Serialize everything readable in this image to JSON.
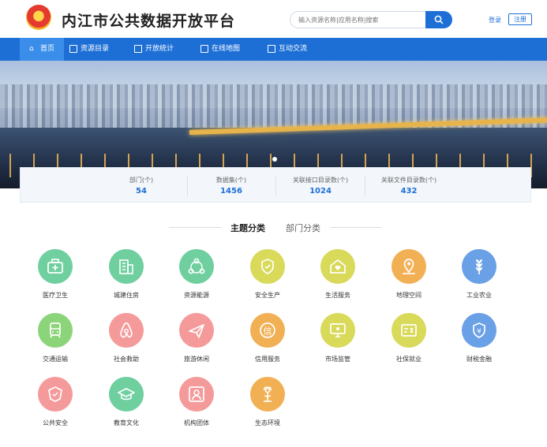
{
  "header": {
    "site_title": "内江市公共数据开放平台",
    "search_placeholder": "输入资源名称|应用名称|搜索",
    "login_label": "登录",
    "register_label": "注册"
  },
  "nav": {
    "items": [
      {
        "label": "首页",
        "icon": "home-icon"
      },
      {
        "label": "资源目录",
        "icon": "catalog-icon"
      },
      {
        "label": "开放统计",
        "icon": "stats-icon"
      },
      {
        "label": "在线地图",
        "icon": "map-icon"
      },
      {
        "label": "互动交流",
        "icon": "chat-icon"
      }
    ]
  },
  "stats": [
    {
      "label": "部门(个)",
      "value": "54"
    },
    {
      "label": "数据集(个)",
      "value": "1456"
    },
    {
      "label": "关联接口目录数(个)",
      "value": "1024"
    },
    {
      "label": "关联文件目录数(个)",
      "value": "432"
    }
  ],
  "tabs": {
    "topic": "主题分类",
    "department": "部门分类"
  },
  "categories": [
    {
      "label": "医疗卫生",
      "color": "#6fcf9f",
      "icon": "medical-kit-icon"
    },
    {
      "label": "城建住房",
      "color": "#6fcf9f",
      "icon": "building-icon"
    },
    {
      "label": "资源能源",
      "color": "#6fcf9f",
      "icon": "network-icon"
    },
    {
      "label": "安全生产",
      "color": "#d9d95a",
      "icon": "shield-icon"
    },
    {
      "label": "生活服务",
      "color": "#d9d95a",
      "icon": "house-heart-icon"
    },
    {
      "label": "地理空间",
      "color": "#f2b055",
      "icon": "map-pin-icon"
    },
    {
      "label": "工业农业",
      "color": "#6aa0e6",
      "icon": "wheat-icon"
    },
    {
      "label": "交通运输",
      "color": "#8cd47a",
      "icon": "train-icon"
    },
    {
      "label": "社会救助",
      "color": "#f59a9a",
      "icon": "airbnb-icon"
    },
    {
      "label": "旅游休闲",
      "color": "#f59a9a",
      "icon": "plane-icon"
    },
    {
      "label": "信用服务",
      "color": "#f2b055",
      "icon": "credit-icon"
    },
    {
      "label": "市场监管",
      "color": "#d9d95a",
      "icon": "monitor-icon"
    },
    {
      "label": "社保就业",
      "color": "#d9d95a",
      "icon": "id-card-icon"
    },
    {
      "label": "财税金融",
      "color": "#6aa0e6",
      "icon": "yuan-shield-icon"
    },
    {
      "label": "公共安全",
      "color": "#f59a9a",
      "icon": "police-badge-icon"
    },
    {
      "label": "教育文化",
      "color": "#6fcf9f",
      "icon": "graduation-cap-icon"
    },
    {
      "label": "机构团体",
      "color": "#f59a9a",
      "icon": "person-frame-icon"
    },
    {
      "label": "生态环境",
      "color": "#f2b055",
      "icon": "flower-icon"
    }
  ]
}
